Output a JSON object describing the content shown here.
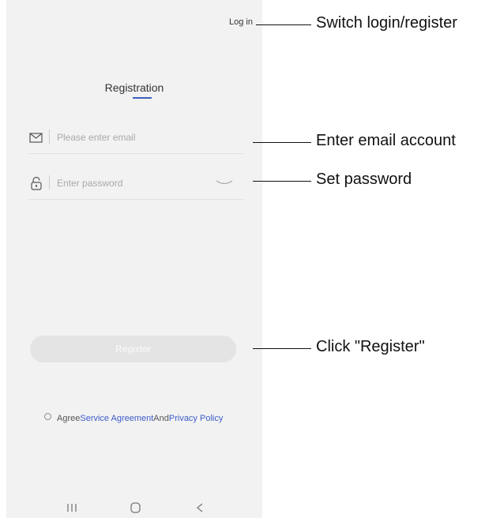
{
  "header": {
    "login_link": "Log in"
  },
  "title": "Registration",
  "email_field": {
    "placeholder": "Please enter email",
    "icon": "mail-icon"
  },
  "password_field": {
    "placeholder": "Enter password",
    "icon": "lock-icon",
    "toggle_icon": "eye-closed-icon"
  },
  "register_button": {
    "label": "Register"
  },
  "agreement": {
    "prefix": "Agree",
    "service_link": "Service Agreement",
    "conjunction": "And",
    "privacy_link": "Privacy Policy"
  },
  "navbar": {
    "recents_icon": "recents-icon",
    "home_icon": "home-icon",
    "back_icon": "back-icon"
  },
  "annotations": {
    "switch": "Switch login/register",
    "email": "Enter email account",
    "password": "Set password",
    "register": "Click \"Register\""
  },
  "colors": {
    "accent": "#3d5cc9",
    "background": "#f2f2f2",
    "button_disabled": "#e4e4e4"
  }
}
